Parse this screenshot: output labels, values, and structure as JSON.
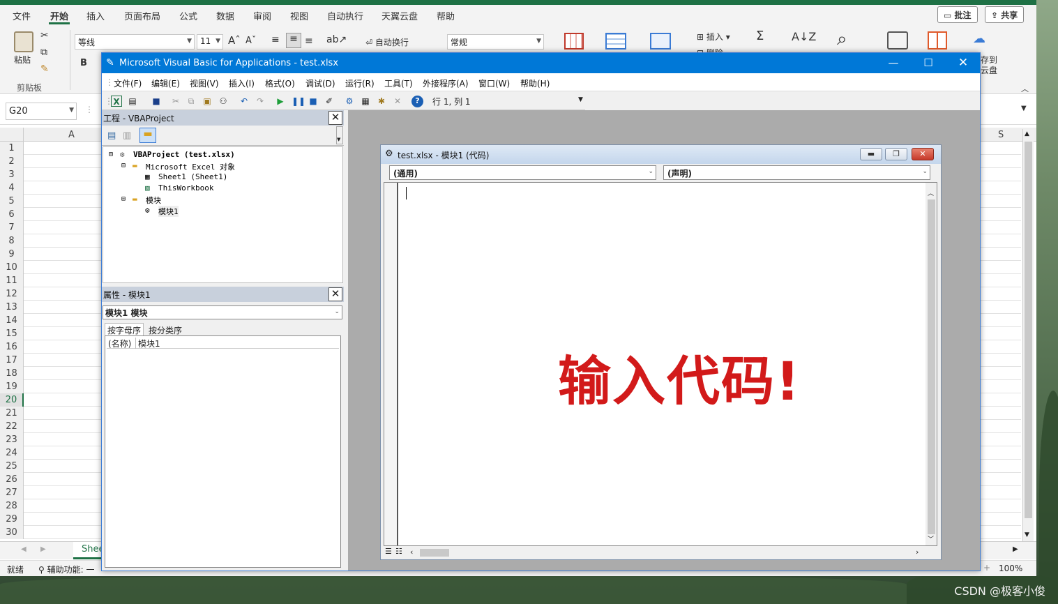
{
  "colors": {
    "excel_green": "#1e7145",
    "vba_title_blue": "#0078d7",
    "overlay_red": "#d21a1a"
  },
  "excel": {
    "tabs": [
      "文件",
      "开始",
      "插入",
      "页面布局",
      "公式",
      "数据",
      "审阅",
      "视图",
      "自动执行",
      "天翼云盘",
      "帮助"
    ],
    "active_tab": "开始",
    "buttons": {
      "comment": "批注",
      "share": "共享"
    },
    "ribbon": {
      "paste": "粘贴",
      "clipboard_group": "剪贴板",
      "font_name": "等线",
      "font_size": "11",
      "grow_font": "A",
      "shrink_font": "A",
      "bold": "B",
      "wrap_text": "自动换行",
      "number_format": "常规",
      "insert": "插入",
      "delete": "删除",
      "save_to": "存到",
      "cloud_disk": "云盘"
    },
    "name_box": "G20",
    "columns": {
      "a": "A",
      "s": "S"
    },
    "rows": [
      "1",
      "2",
      "3",
      "4",
      "5",
      "6",
      "7",
      "8",
      "9",
      "10",
      "11",
      "12",
      "13",
      "14",
      "15",
      "16",
      "17",
      "18",
      "19",
      "20",
      "21",
      "22",
      "23",
      "24",
      "25",
      "26",
      "27",
      "28",
      "29",
      "30"
    ],
    "selected_row": "20",
    "sheet_tab": "Shee",
    "status": {
      "ready": "就绪",
      "accessibility": "辅助功能: 一",
      "zoom": "100%"
    }
  },
  "vbe": {
    "title": "Microsoft Visual Basic for Applications - test.xlsx",
    "menu": [
      "文件(F)",
      "编辑(E)",
      "视图(V)",
      "插入(I)",
      "格式(O)",
      "调试(D)",
      "运行(R)",
      "工具(T)",
      "外接程序(A)",
      "窗口(W)",
      "帮助(H)"
    ],
    "cursor_pos": "行 1, 列 1",
    "project": {
      "header": "工程 - VBAProject",
      "nodes": [
        "VBAProject (test.xlsx)",
        "Microsoft Excel 对象",
        "Sheet1 (Sheet1)",
        "ThisWorkbook",
        "模块",
        "模块1"
      ]
    },
    "properties": {
      "header": "属性 - 模块1",
      "object": "模块1 模块",
      "tabs": [
        "按字母序",
        "按分类序"
      ],
      "row_name": "(名称)",
      "row_value": "模块1"
    },
    "code_window": {
      "title": "test.xlsx - 模块1 (代码)",
      "object_combo": "(通用)",
      "proc_combo": "(声明)"
    }
  },
  "overlay": {
    "text": "输入代码!"
  },
  "watermark": "CSDN @极客小俊"
}
